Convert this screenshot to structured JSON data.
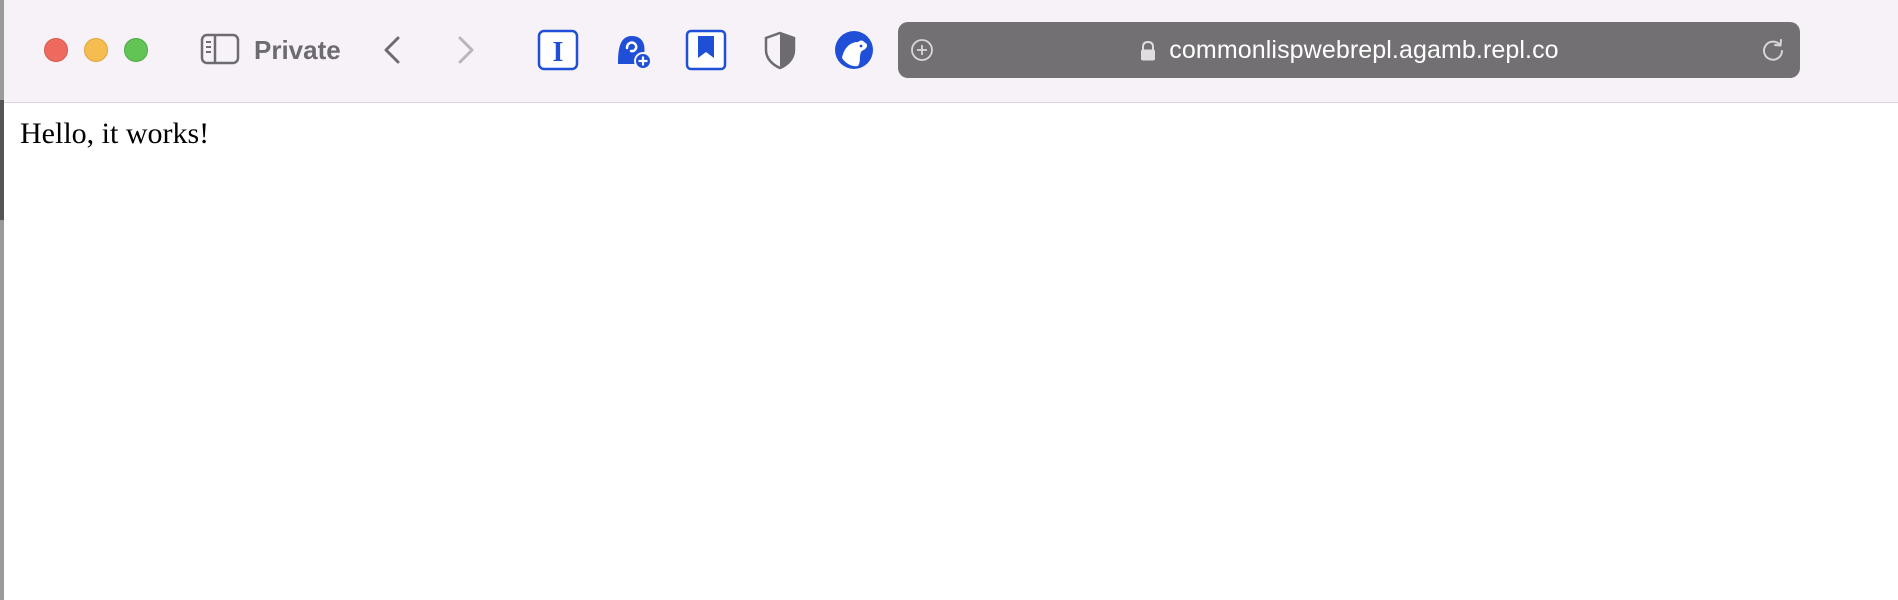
{
  "window": {
    "controls": [
      "close",
      "minimize",
      "zoom"
    ]
  },
  "toolbar": {
    "mode_label": "Private",
    "extensions": [
      "instapaper-icon",
      "ghostery-icon",
      "bookmark-icon",
      "shield-icon",
      "bear-icon"
    ],
    "accent_color": "#1f4fd6"
  },
  "address_bar": {
    "url": "commonlispwebrepl.agamb.repl.co",
    "secure": true
  },
  "page": {
    "body_text": "Hello, it works!"
  }
}
